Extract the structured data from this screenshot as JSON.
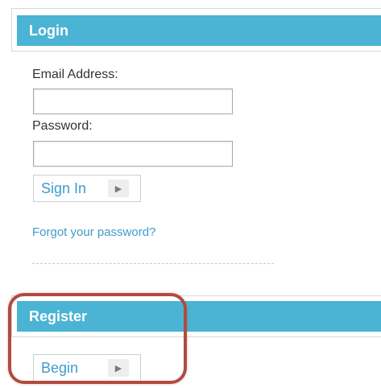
{
  "login": {
    "header": "Login",
    "email_label": "Email Address:",
    "email_value": "",
    "password_label": "Password:",
    "password_value": "",
    "sign_in_label": "Sign In",
    "forgot_link": "Forgot your password?"
  },
  "register": {
    "header": "Register",
    "begin_label": "Begin"
  },
  "icons": {
    "button_arrow": "play-arrow-icon"
  },
  "colors": {
    "header_bg": "#4bb3d3",
    "link": "#3f9ccb",
    "highlight": "#b24b40"
  }
}
